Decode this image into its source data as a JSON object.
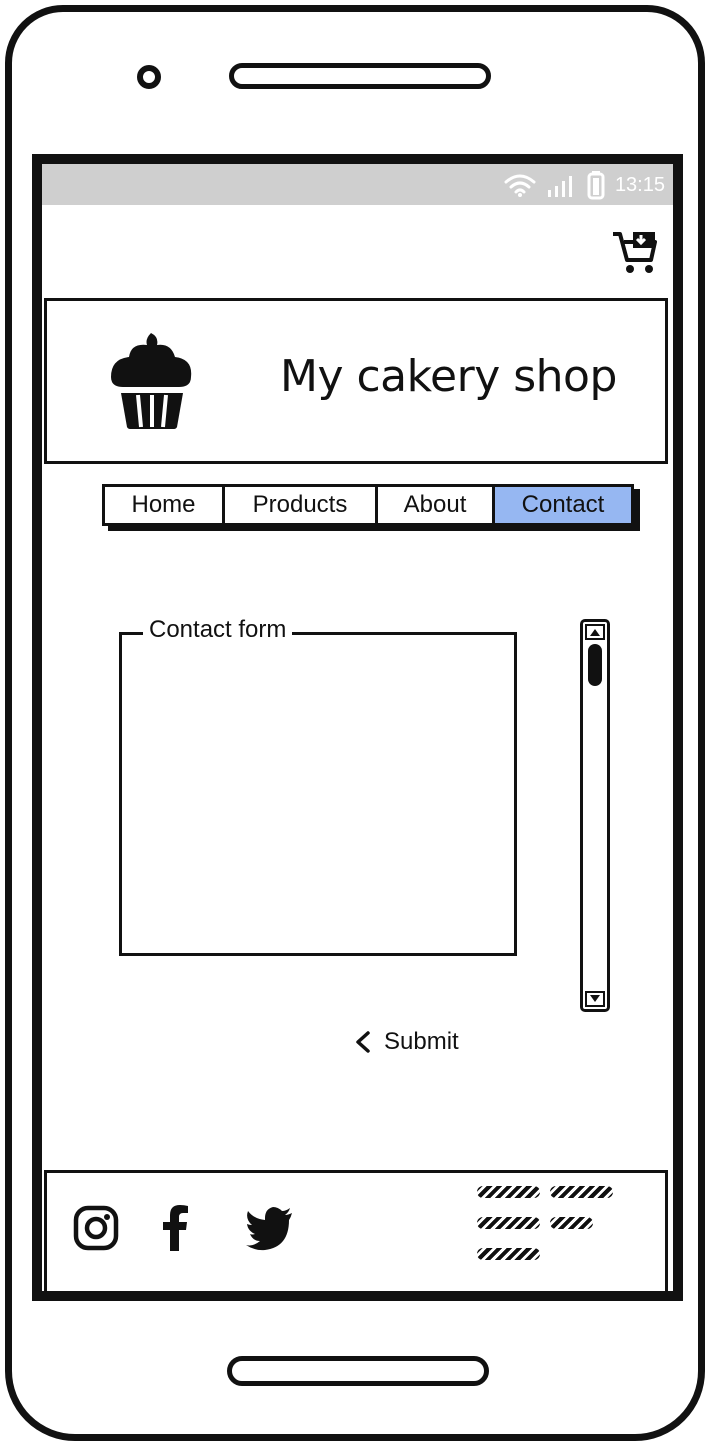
{
  "status_bar": {
    "time": "13:15",
    "icons": [
      "wifi-icon",
      "signal-icon",
      "battery-icon"
    ]
  },
  "header": {
    "cart_icon": "cart-download-icon",
    "logo_icon": "cupcake-icon",
    "brand": "My cakery shop"
  },
  "nav": {
    "items": [
      {
        "label": "Home",
        "active": false
      },
      {
        "label": "Products",
        "active": false
      },
      {
        "label": "About",
        "active": false
      },
      {
        "label": "Contact",
        "active": true
      }
    ],
    "active_color": "#96b7f2"
  },
  "contact_form": {
    "legend": "Contact form"
  },
  "submit": {
    "label": "Submit",
    "icon": "chevron-left-icon"
  },
  "footer": {
    "social_icons": [
      "instagram-icon",
      "facebook-icon",
      "twitter-icon"
    ]
  },
  "colors": {
    "status_bar_bg": "#cfcfcf",
    "ink": "#111111"
  }
}
